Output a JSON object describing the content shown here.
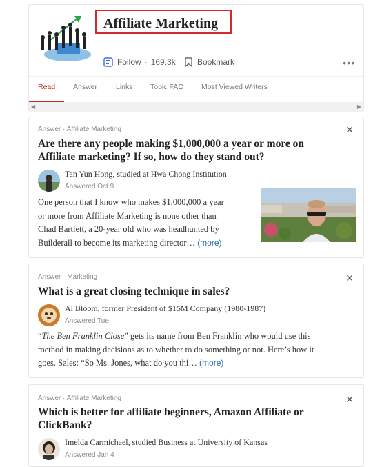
{
  "topic": {
    "title": "Affiliate Marketing",
    "follow_label": "Follow",
    "follow_count": "169.3k",
    "bookmark_label": "Bookmark",
    "more_label": "•••"
  },
  "tabs": [
    "Read",
    "Answer",
    "Links",
    "Topic FAQ",
    "Most Viewed Writers"
  ],
  "active_tab": "Read",
  "feed": [
    {
      "meta": "Answer · Affiliate Marketing",
      "question": "Are there any people making $1,000,000 a year or more on Affiliate marketing? If so, how do they stand out?",
      "author": "Tan Yun Hong, studied at Hwa Chong Institution",
      "date": "Answered Oct 9",
      "lines": [
        "One person that I know who makes $1,000,000 a year",
        "or more from Affiliate Marketing is none other than",
        "Chad Bartlett, a 20-year old who was headhunted by",
        "Builderall to become its marketing director…"
      ],
      "more": "(more)"
    },
    {
      "meta": "Answer · Marketing",
      "question": "What is a great closing technique in sales?",
      "author": "Al Bloom, former President of $15M Company (1980-1987)",
      "date": "Answered Tue",
      "line1_italic": "The Ben Franklin Close",
      "line1_rest": " gets its name from Ben Franklin who would use this",
      "lines": [
        "method in making decisions as to whether to do something or not. Here’s how it",
        "goes. Sales: “So Ms. Jones, what do you thi…"
      ],
      "more": "(more)"
    },
    {
      "meta": "Answer · Affiliate Marketing",
      "question": "Which is better for affiliate beginners, Amazon Affiliate or ClickBank?",
      "author": "Imelda Carmichael, studied Business at University of Kansas",
      "date": "Answered Jan 4"
    }
  ]
}
